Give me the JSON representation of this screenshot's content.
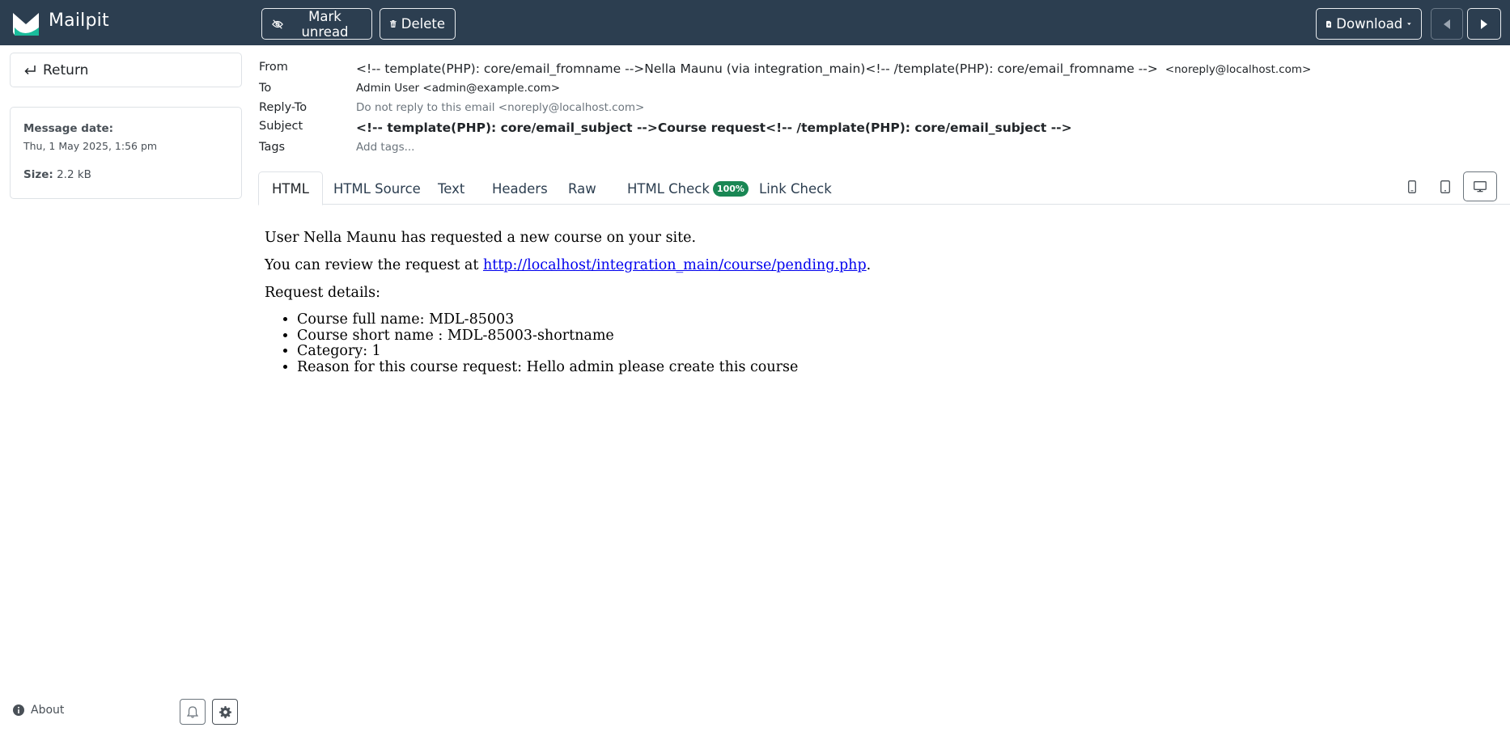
{
  "app": {
    "name": "Mailpit"
  },
  "toolbar": {
    "mark_unread": "Mark unread",
    "delete": "Delete",
    "download": "Download"
  },
  "sidebar": {
    "return_label": "Return",
    "message_date_label": "Message date:",
    "message_date_value": "Thu, 1 May 2025, 1:56 pm",
    "size_label": "Size:",
    "size_value": "2.2 kB",
    "about_label": "About"
  },
  "headers": {
    "from_label": "From",
    "from_name": "<!-- template(PHP): core/email_fromname -->Nella Maunu (via integration_main)<!-- /template(PHP): core/email_fromname -->",
    "from_email": "<noreply@localhost.com>",
    "to_label": "To",
    "to_value": "Admin User <admin@example.com>",
    "reply_to_label": "Reply-To",
    "reply_to_value": "Do not reply to this email <noreply@localhost.com>",
    "subject_label": "Subject",
    "subject_value": "<!-- template(PHP): core/email_subject -->Course request<!-- /template(PHP): core/email_subject -->",
    "tags_label": "Tags",
    "tags_placeholder": "Add tags..."
  },
  "tabs": {
    "html": "HTML",
    "html_source": "HTML Source",
    "text": "Text",
    "headers": "Headers",
    "raw": "Raw",
    "html_check": "HTML Check",
    "html_check_badge": "100%",
    "link_check": "Link Check",
    "active": "HTML"
  },
  "email_body": {
    "line1": "User Nella Maunu has requested a new course on your site.",
    "line2_prefix": "You can review the request at ",
    "line2_link": "http://localhost/integration_main/course/pending.php",
    "line2_suffix": ".",
    "line3": "Request details:",
    "details": [
      "Course full name: MDL-85003",
      "Course short name : MDL-85003-shortname",
      "Category: 1",
      "Reason for this course request: Hello admin please create this course"
    ]
  },
  "colors": {
    "topbar": "#2c3e50",
    "badge": "#198754",
    "link": "#0000ee",
    "logo_accent": "#1abc9c"
  },
  "icons": [
    "logo-icon",
    "eye-slash-icon",
    "trash-icon",
    "download-icon",
    "caret-down-icon",
    "arrow-left-icon",
    "arrow-right-icon",
    "return-arrow-icon",
    "info-icon",
    "bell-icon",
    "gear-icon",
    "phone-icon",
    "tablet-icon",
    "desktop-icon"
  ]
}
